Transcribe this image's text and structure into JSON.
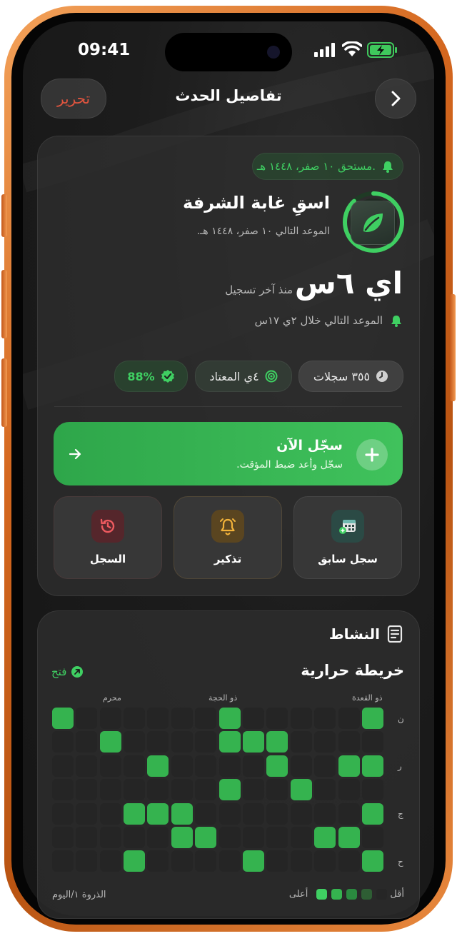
{
  "status": {
    "time": "09:41"
  },
  "nav": {
    "title": "تفاصيل الحدث",
    "edit_label": "تحرير"
  },
  "event": {
    "due_badge": "مستحق ١٠ صفر، ١٤٤٨ هـ.",
    "name": "اسقِ غابة الشرفة",
    "next_date": "الموعد التالي ١٠ صفر، ١٤٤٨ هـ.",
    "elapsed": "اي ٦س",
    "elapsed_caption": "منذ آخر تسجيل",
    "next_in": "الموعد التالي خلال ٢ي ١٧س",
    "progress_fraction": 0.88
  },
  "stats": {
    "logs": "٣٥٥ سجلات",
    "usual": "٤ي المعتاد",
    "percent": "88%"
  },
  "log_now": {
    "title": "سجّل الآن",
    "subtitle": "سجّل وأعد ضبط المؤقت."
  },
  "tiles": {
    "past_log": "سجل سابق",
    "reminder": "تذكير",
    "history": "السجل"
  },
  "activity": {
    "title": "النشاط",
    "heatmap_title": "خريطة حرارية",
    "open_label": "فتح",
    "months": [
      "ذو القعدة",
      "ذو الحجة",
      "محرم"
    ],
    "day_labels": [
      "ن",
      "ر",
      "ج",
      "ح"
    ],
    "legend_less": "أقل",
    "legend_more": "أعلى",
    "peak": "الذروة ١/اليوم",
    "colors": {
      "empty": "#252525",
      "filled": "#35b34f",
      "dim": "#2e5e34"
    },
    "grid": [
      [
        1,
        0,
        0,
        0,
        0,
        0,
        1,
        0,
        0,
        0,
        0,
        0,
        0,
        1
      ],
      [
        0,
        0,
        0,
        0,
        1,
        1,
        1,
        0,
        0,
        0,
        0,
        1,
        0,
        0
      ],
      [
        1,
        1,
        0,
        0,
        1,
        0,
        0,
        0,
        0,
        1,
        0,
        0,
        0,
        0
      ],
      [
        0,
        0,
        0,
        1,
        0,
        0,
        1,
        0,
        0,
        0,
        0,
        0,
        0,
        0
      ],
      [
        1,
        0,
        0,
        0,
        0,
        0,
        0,
        0,
        1,
        1,
        1,
        0,
        0,
        0
      ],
      [
        0,
        1,
        1,
        0,
        0,
        0,
        0,
        1,
        1,
        0,
        0,
        0,
        0,
        0
      ],
      [
        1,
        0,
        0,
        0,
        0,
        1,
        0,
        0,
        0,
        0,
        1,
        0,
        0,
        0
      ]
    ]
  }
}
